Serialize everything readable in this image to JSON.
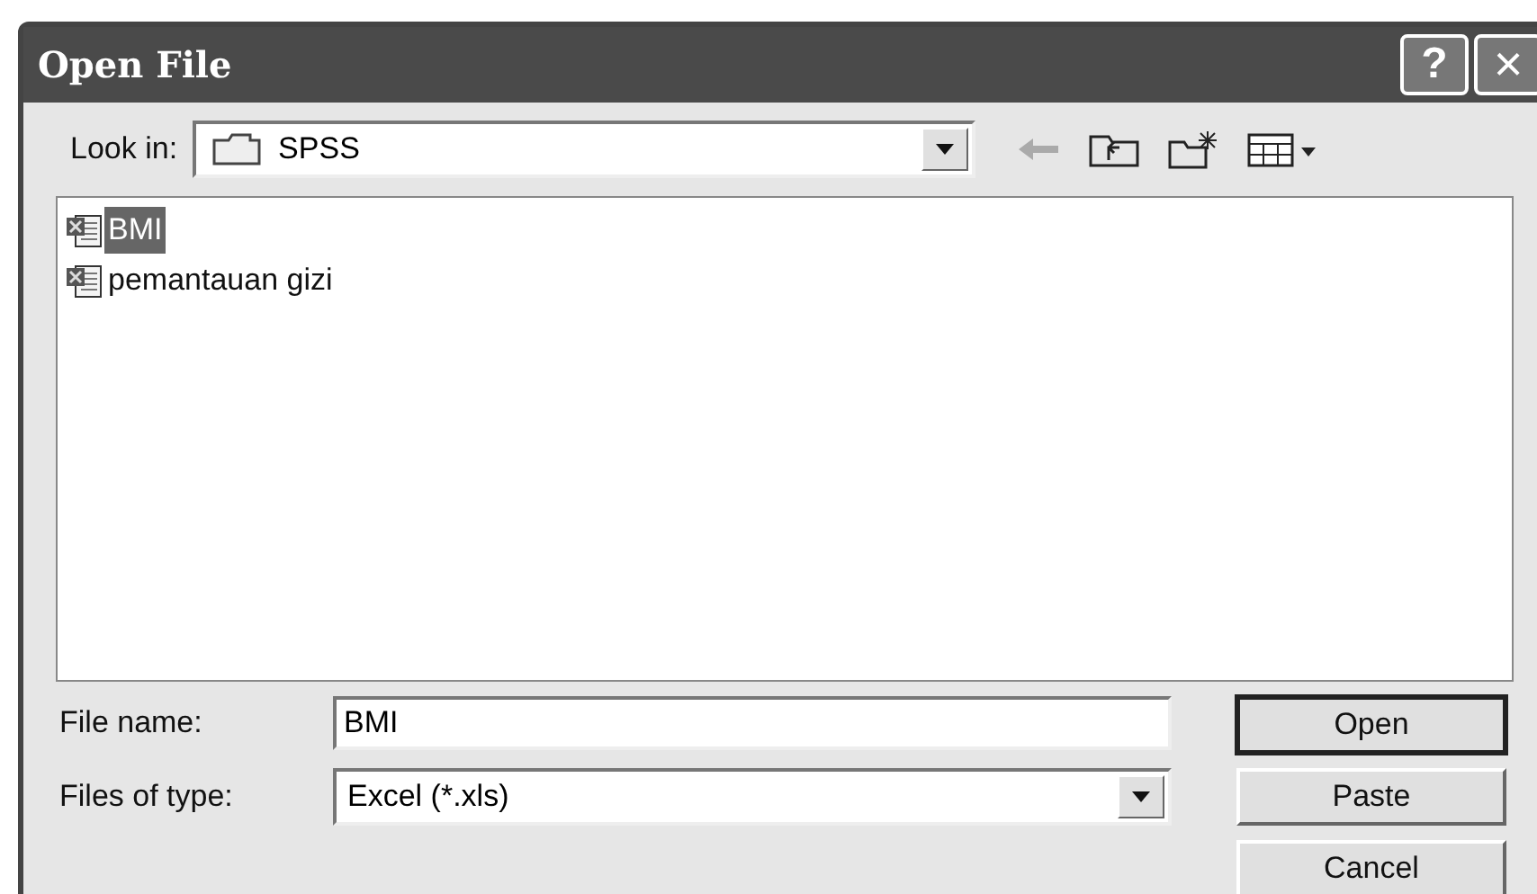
{
  "window": {
    "title": "Open File",
    "help": "?",
    "close": "×"
  },
  "look_in": {
    "label": "Look in:",
    "value": "SPSS"
  },
  "files": [
    {
      "name": "BMI",
      "selected": true
    },
    {
      "name": "pemantauan gizi",
      "selected": false
    }
  ],
  "file_name": {
    "label": "File name:",
    "value": "BMI"
  },
  "file_type": {
    "label": "Files of type:",
    "value": "Excel (*.xls)"
  },
  "buttons": [
    {
      "label": "Open",
      "default": true
    },
    {
      "label": "Paste",
      "default": false
    },
    {
      "label": "Cancel",
      "default": false
    }
  ]
}
